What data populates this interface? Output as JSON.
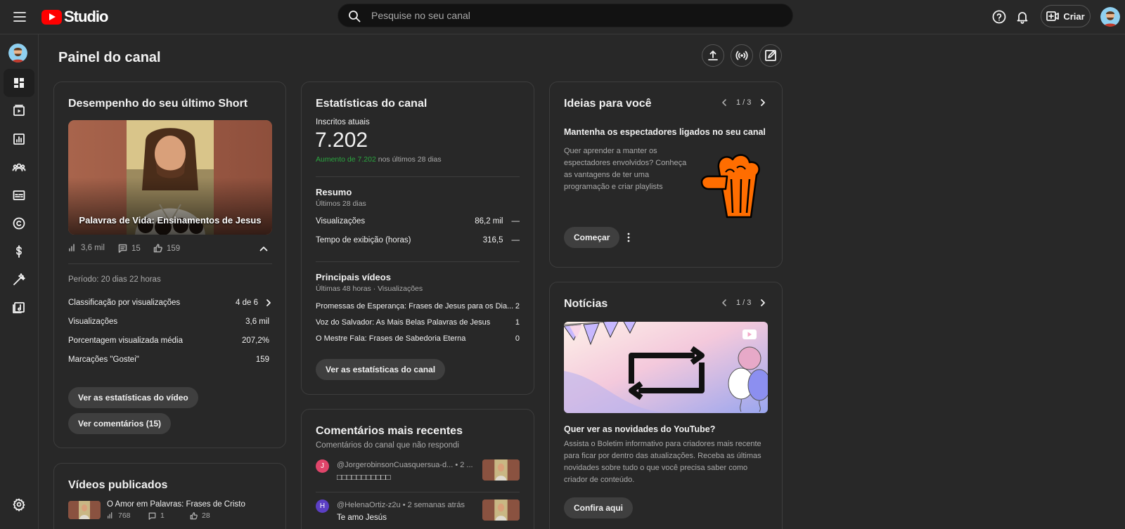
{
  "header": {
    "logo_text": "Studio",
    "search_placeholder": "Pesquise no seu canal",
    "create_label": "Criar"
  },
  "page": {
    "title": "Painel do canal"
  },
  "last_short": {
    "title": "Desempenho do seu último Short",
    "video_title": "Palavras de Vida: Ensinamentos de Jesus",
    "views": "3,6 mil",
    "comments": "15",
    "likes": "159",
    "period": "Período: 20 dias 22 horas",
    "rows": [
      {
        "label": "Classificação por visualizações",
        "value": "4 de 6"
      },
      {
        "label": "Visualizações",
        "value": "3,6 mil"
      },
      {
        "label": "Porcentagem visualizada média",
        "value": "207,2%"
      },
      {
        "label": "Marcações \"Gostei\"",
        "value": "159"
      }
    ],
    "btn_stats": "Ver as estatísticas do vídeo",
    "btn_comments": "Ver comentários (15)"
  },
  "published": {
    "title": "Vídeos publicados",
    "video_title": "O Amor em Palavras: Frases de Cristo",
    "views": "768",
    "comments": "1",
    "likes": "28"
  },
  "channel_stats": {
    "title": "Estatísticas do canal",
    "subs_label": "Inscritos atuais",
    "subs_value": "7.202",
    "growth_highlight": "Aumento de 7.202",
    "growth_rest": "nos últimos 28 dias",
    "summary_title": "Resumo",
    "summary_period": "Últimos 28 dias",
    "summary_rows": [
      {
        "label": "Visualizações",
        "value": "86,2 mil",
        "trend": "—"
      },
      {
        "label": "Tempo de exibição (horas)",
        "value": "316,5",
        "trend": "—"
      }
    ],
    "top_title": "Principais vídeos",
    "top_period": "Últimas 48 horas · Visualizações",
    "top_rows": [
      {
        "label": "Promessas de Esperança: Frases de Jesus para os Dia...",
        "value": "2"
      },
      {
        "label": "Voz do Salvador: As Mais Belas Palavras de Jesus",
        "value": "1"
      },
      {
        "label": "O Mestre Fala: Frases de Sabedoria Eterna",
        "value": "0"
      }
    ],
    "btn": "Ver as estatísticas do canal"
  },
  "comments": {
    "title": "Comentários mais recentes",
    "subtitle": "Comentários do canal que não respondi",
    "items": [
      {
        "initial": "J",
        "color": "#e0456a",
        "author": "@JorgerobinsonCuasquersua-d...",
        "time": "• 2 ...",
        "text": "□□□□□□□□□□□"
      },
      {
        "initial": "H",
        "color": "#5b3fc4",
        "author": "@HelenaOrtiz-z2u",
        "time": "• 2 semanas atrás",
        "text": "Te amo Jesús"
      }
    ]
  },
  "ideas": {
    "title": "Ideias para você",
    "pager": "1 / 3",
    "heading": "Mantenha os espectadores ligados no seu canal",
    "body": "Quer aprender a manter os espectadores envolvidos? Conheça as vantagens de ter uma programação e criar playlists",
    "btn": "Começar",
    "accent": "#ff6d00"
  },
  "news": {
    "title": "Notícias",
    "pager": "1 / 3",
    "heading": "Quer ver as novidades do YouTube?",
    "body": "Assista o Boletim informativo para criadores mais recente para ficar por dentro das atualizações. Receba as últimas novidades sobre tudo o que você precisa saber como criador de conteúdo.",
    "btn": "Confira aqui"
  },
  "colors": {
    "background": "#282828",
    "card_border": "#3d3d3d",
    "growth_green": "#2ba640",
    "youtube_red": "#ff0000"
  },
  "icons": [
    "menu-icon",
    "search-icon",
    "help-icon",
    "bell-icon",
    "create-icon",
    "dashboard-icon",
    "content-icon",
    "analytics-icon",
    "community-icon",
    "subtitles-icon",
    "copyright-icon",
    "earn-icon",
    "customize-icon",
    "audio-library-icon",
    "settings-icon",
    "upload-icon",
    "live-icon",
    "edit-icon",
    "views-icon",
    "comment-icon",
    "like-icon",
    "chevron-up-icon",
    "chevron-right-icon",
    "chevron-left-icon",
    "more-icon",
    "popcorn-icon"
  ]
}
